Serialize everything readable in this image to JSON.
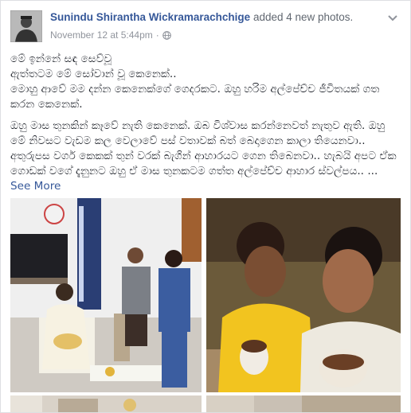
{
  "post": {
    "author": "Sunindu Shirantha Wickramarachchige",
    "action": " added 4 new photos.",
    "timestamp": "November 12 at 5:44pm",
    "separator": "·",
    "paragraph1": "මේ ඉන්නේ සඳ සෙව්වූ\nඇත්තටම මේ සෝවාන් වූ කෙනෙක්..\nමොහු ආවේ මම දන්න කෙනෙක්ගේ ගෙදරකට. ඔහු හරිම අල්පේච්ච ජීවිතයක් ගත කරන කෙනෙක්.",
    "paragraph2": "ඔහු මාස තුනකින් කෑවේ නැති කෙනෙක්. ඔබ විශ්වාස කරන්නෙවත් නැතුව ඇති. ඔහු මේ නිවසට වැඩම කල වෙලාවේ පස් වතාවක් බත් බෙදාගෙන කාලා තියෙනවා.. අතුරුපස වර්ග කෙකක් තුන් වරක් බැගින් ආහාරයට ගෙන තිබෙනවා.. හැබයි අපට ඒක ගොඩක් වගේ දැනුනට ඔහු ඒ මාස තුනකටම ගත්ත අල්පේච්ච ආහාර ස්වල්පය.. ...",
    "see_more": " See More"
  },
  "icons": {
    "options": "chevron-down-icon",
    "privacy": "globe-icon"
  },
  "colors": {
    "link": "#365899",
    "meta": "#90949c",
    "text": "#1d2129"
  }
}
